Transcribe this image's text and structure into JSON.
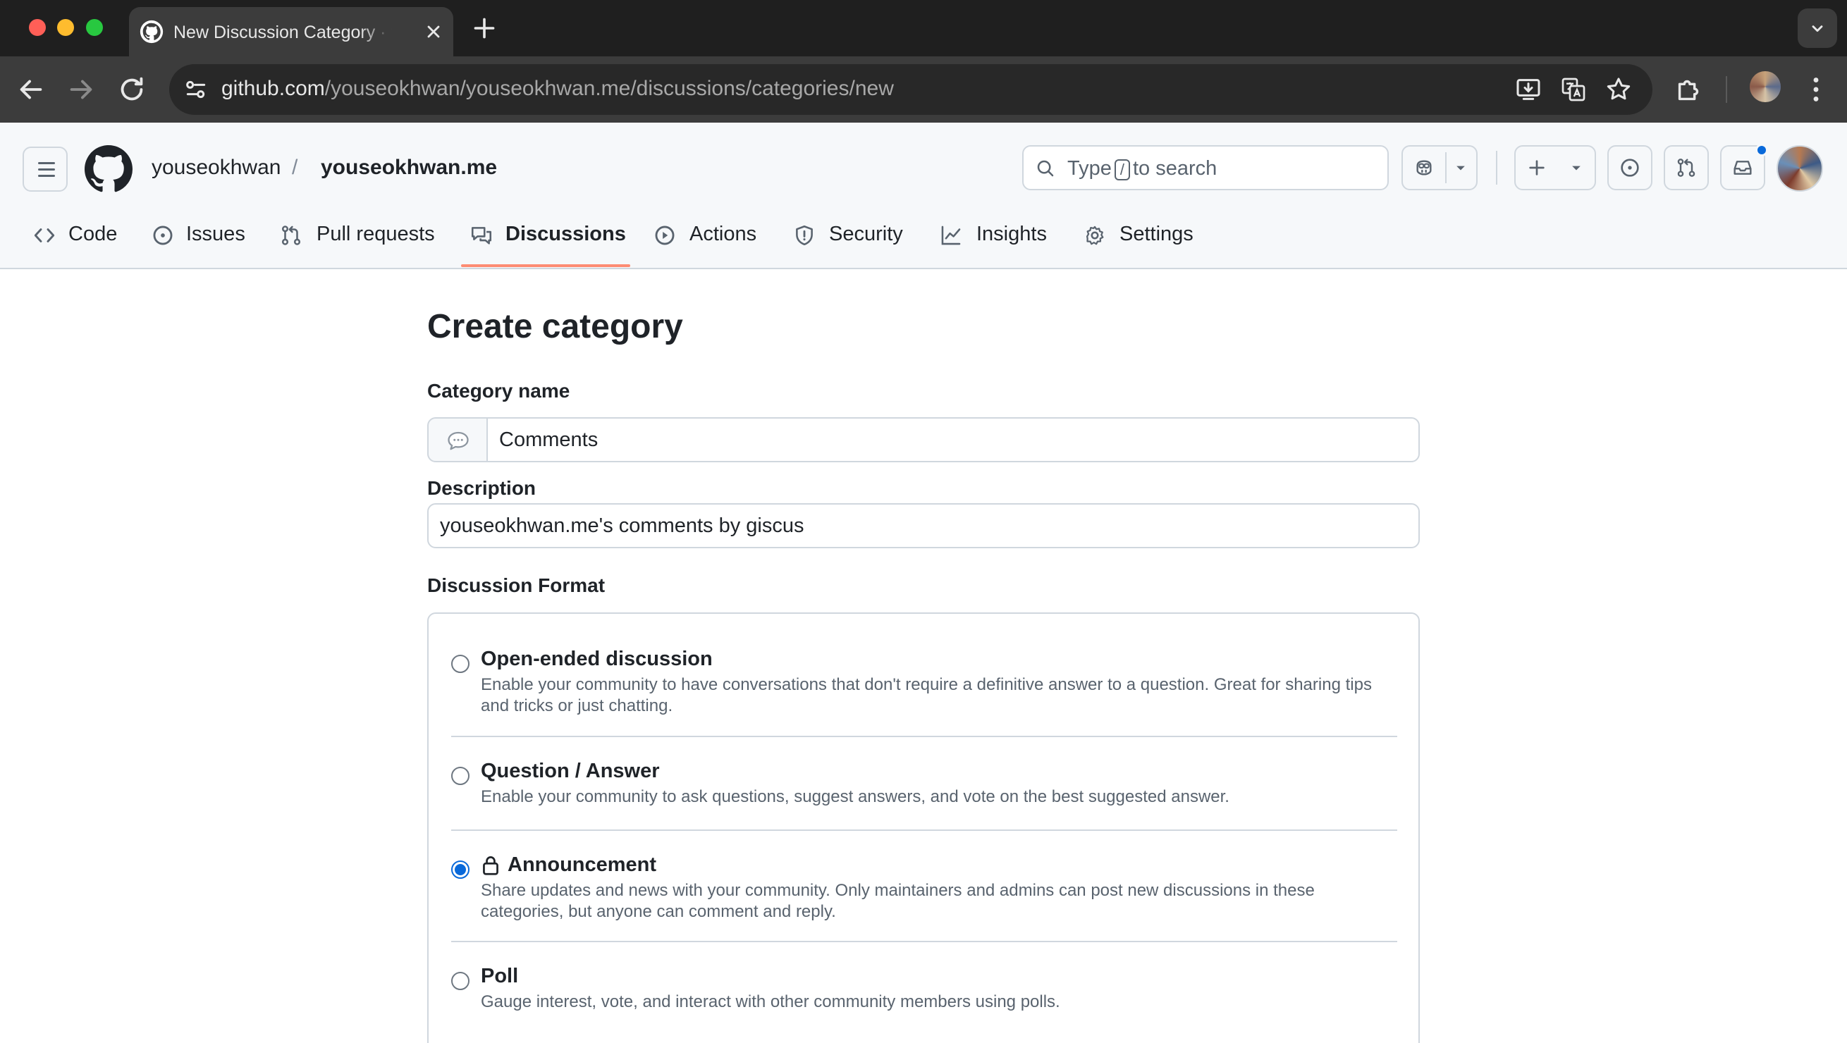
{
  "browser": {
    "tab_title": "New Discussion Category · youseokhwan/youseokhwan.me",
    "url_host": "github.com",
    "url_path": "/youseokhwan/youseokhwan.me/discussions/categories/new"
  },
  "header": {
    "owner": "youseokhwan",
    "separator": "/",
    "repo": "youseokhwan.me",
    "search": {
      "prefix": "Type",
      "key": "/",
      "suffix": "to search"
    },
    "accent_color": "#0969da"
  },
  "repo_nav": {
    "items": [
      {
        "label": "Code",
        "icon": "code-icon"
      },
      {
        "label": "Issues",
        "icon": "issue-opened-icon"
      },
      {
        "label": "Pull requests",
        "icon": "git-pull-request-icon"
      },
      {
        "label": "Discussions",
        "icon": "comment-discussion-icon",
        "active": true
      },
      {
        "label": "Actions",
        "icon": "play-icon"
      },
      {
        "label": "Security",
        "icon": "shield-icon"
      },
      {
        "label": "Insights",
        "icon": "graph-icon"
      },
      {
        "label": "Settings",
        "icon": "gear-icon"
      }
    ],
    "active_underline_color": "#fd8c73"
  },
  "form": {
    "title": "Create category",
    "name_label": "Category name",
    "name_value": "Comments",
    "emoji": "speech-balloon-icon",
    "description_label": "Description",
    "description_value": "youseokhwan.me's comments by giscus",
    "format_label": "Discussion Format",
    "formats": [
      {
        "title": "Open-ended discussion",
        "description": "Enable your community to have conversations that don't require a definitive answer to a question. Great for sharing tips and tricks or just chatting.",
        "selected": false
      },
      {
        "title": "Question / Answer",
        "description": "Enable your community to ask questions, suggest answers, and vote on the best suggested answer.",
        "selected": false
      },
      {
        "title": "Announcement",
        "description": "Share updates and news with your community. Only maintainers and admins can post new discussions in these categories, but anyone can comment and reply.",
        "selected": true,
        "icon": "lock-icon"
      },
      {
        "title": "Poll",
        "description": "Gauge interest, vote, and interact with other community members using polls.",
        "selected": false
      }
    ]
  }
}
